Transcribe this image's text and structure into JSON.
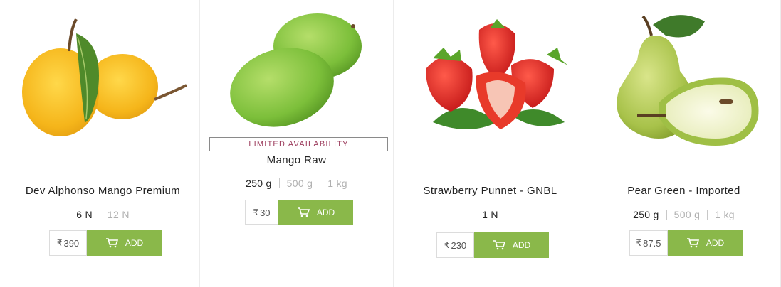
{
  "currency_symbol": "₹",
  "colors": {
    "accent_green": "#8ab84a",
    "badge_text": "#9b3a5b"
  },
  "products": [
    {
      "name": "Dev Alphonso Mango Premium",
      "sizes": [
        "6 N",
        "12 N"
      ],
      "active_size": 0,
      "price": "390",
      "add_label": "ADD",
      "image": "alphonso-mango-image"
    },
    {
      "badge": "LIMITED AVAILABILITY",
      "name": "Mango Raw",
      "sizes": [
        "250 g",
        "500 g",
        "1 kg"
      ],
      "active_size": 0,
      "price": "30",
      "add_label": "ADD",
      "image": "raw-mango-image"
    },
    {
      "name": "Strawberry Punnet - GNBL",
      "sizes": [
        "1 N"
      ],
      "active_size": 0,
      "price": "230",
      "add_label": "ADD",
      "image": "strawberry-image"
    },
    {
      "name": "Pear Green - Imported",
      "sizes": [
        "250 g",
        "500 g",
        "1 kg"
      ],
      "active_size": 0,
      "price": "87.5",
      "add_label": "ADD",
      "image": "green-pear-image"
    }
  ]
}
